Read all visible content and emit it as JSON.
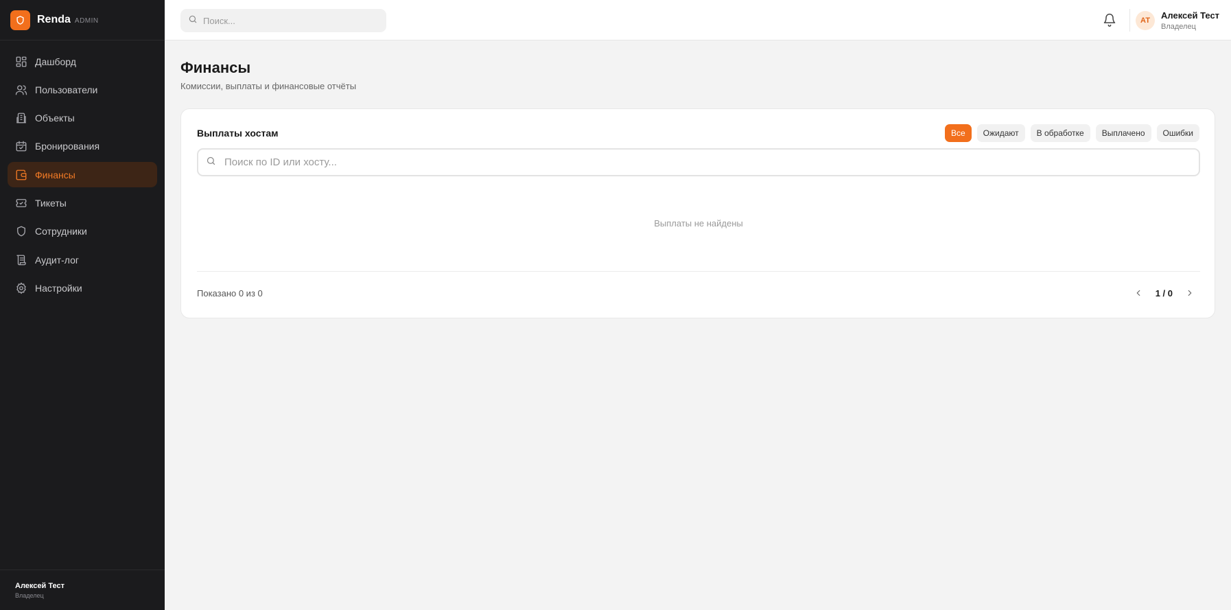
{
  "brand": {
    "name": "Renda",
    "tag": "ADMIN"
  },
  "sidebar": {
    "items": [
      {
        "label": "Дашборд",
        "icon": "dashboard-icon"
      },
      {
        "label": "Пользователи",
        "icon": "users-icon"
      },
      {
        "label": "Объекты",
        "icon": "building-icon"
      },
      {
        "label": "Бронирования",
        "icon": "calendar-icon"
      },
      {
        "label": "Финансы",
        "icon": "wallet-icon",
        "active": true
      },
      {
        "label": "Тикеты",
        "icon": "ticket-icon"
      },
      {
        "label": "Сотрудники",
        "icon": "shield-icon"
      },
      {
        "label": "Аудит-лог",
        "icon": "scroll-icon"
      },
      {
        "label": "Настройки",
        "icon": "gear-icon"
      }
    ],
    "footer": {
      "name": "Алексей Тест",
      "role": "Владелец"
    }
  },
  "topbar": {
    "search_placeholder": "Поиск...",
    "user": {
      "initials": "АТ",
      "name": "Алексей Тест",
      "role": "Владелец"
    }
  },
  "main": {
    "title": "Финансы",
    "subtitle": "Комиссии, выплаты и финансовые отчёты"
  },
  "card": {
    "title": "Выплаты хостам",
    "filters": [
      "Все",
      "Ожидают",
      "В обработке",
      "Выплачено",
      "Ошибки"
    ],
    "active_filter": "Все",
    "search_placeholder": "Поиск по ID или хосту...",
    "empty_text": "Выплаты не найдены",
    "shown_text": "Показано 0 из 0",
    "page_text": "1 / 0"
  },
  "colors": {
    "accent": "#f26f1c",
    "sidebar_bg": "#1b1b1d",
    "active_bg": "#3d2516"
  }
}
